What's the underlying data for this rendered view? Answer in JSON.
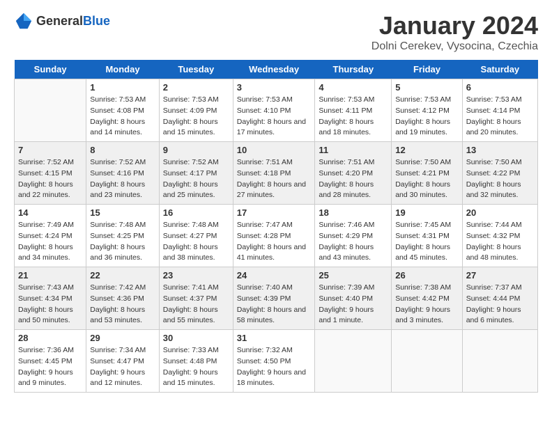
{
  "header": {
    "logo_general": "General",
    "logo_blue": "Blue",
    "title": "January 2024",
    "subtitle": "Dolni Cerekev, Vysocina, Czechia"
  },
  "weekdays": [
    "Sunday",
    "Monday",
    "Tuesday",
    "Wednesday",
    "Thursday",
    "Friday",
    "Saturday"
  ],
  "weeks": [
    [
      {
        "date": "",
        "sunrise": "",
        "sunset": "",
        "daylight": ""
      },
      {
        "date": "1",
        "sunrise": "Sunrise: 7:53 AM",
        "sunset": "Sunset: 4:08 PM",
        "daylight": "Daylight: 8 hours and 14 minutes."
      },
      {
        "date": "2",
        "sunrise": "Sunrise: 7:53 AM",
        "sunset": "Sunset: 4:09 PM",
        "daylight": "Daylight: 8 hours and 15 minutes."
      },
      {
        "date": "3",
        "sunrise": "Sunrise: 7:53 AM",
        "sunset": "Sunset: 4:10 PM",
        "daylight": "Daylight: 8 hours and 17 minutes."
      },
      {
        "date": "4",
        "sunrise": "Sunrise: 7:53 AM",
        "sunset": "Sunset: 4:11 PM",
        "daylight": "Daylight: 8 hours and 18 minutes."
      },
      {
        "date": "5",
        "sunrise": "Sunrise: 7:53 AM",
        "sunset": "Sunset: 4:12 PM",
        "daylight": "Daylight: 8 hours and 19 minutes."
      },
      {
        "date": "6",
        "sunrise": "Sunrise: 7:53 AM",
        "sunset": "Sunset: 4:14 PM",
        "daylight": "Daylight: 8 hours and 20 minutes."
      }
    ],
    [
      {
        "date": "7",
        "sunrise": "Sunrise: 7:52 AM",
        "sunset": "Sunset: 4:15 PM",
        "daylight": "Daylight: 8 hours and 22 minutes."
      },
      {
        "date": "8",
        "sunrise": "Sunrise: 7:52 AM",
        "sunset": "Sunset: 4:16 PM",
        "daylight": "Daylight: 8 hours and 23 minutes."
      },
      {
        "date": "9",
        "sunrise": "Sunrise: 7:52 AM",
        "sunset": "Sunset: 4:17 PM",
        "daylight": "Daylight: 8 hours and 25 minutes."
      },
      {
        "date": "10",
        "sunrise": "Sunrise: 7:51 AM",
        "sunset": "Sunset: 4:18 PM",
        "daylight": "Daylight: 8 hours and 27 minutes."
      },
      {
        "date": "11",
        "sunrise": "Sunrise: 7:51 AM",
        "sunset": "Sunset: 4:20 PM",
        "daylight": "Daylight: 8 hours and 28 minutes."
      },
      {
        "date": "12",
        "sunrise": "Sunrise: 7:50 AM",
        "sunset": "Sunset: 4:21 PM",
        "daylight": "Daylight: 8 hours and 30 minutes."
      },
      {
        "date": "13",
        "sunrise": "Sunrise: 7:50 AM",
        "sunset": "Sunset: 4:22 PM",
        "daylight": "Daylight: 8 hours and 32 minutes."
      }
    ],
    [
      {
        "date": "14",
        "sunrise": "Sunrise: 7:49 AM",
        "sunset": "Sunset: 4:24 PM",
        "daylight": "Daylight: 8 hours and 34 minutes."
      },
      {
        "date": "15",
        "sunrise": "Sunrise: 7:48 AM",
        "sunset": "Sunset: 4:25 PM",
        "daylight": "Daylight: 8 hours and 36 minutes."
      },
      {
        "date": "16",
        "sunrise": "Sunrise: 7:48 AM",
        "sunset": "Sunset: 4:27 PM",
        "daylight": "Daylight: 8 hours and 38 minutes."
      },
      {
        "date": "17",
        "sunrise": "Sunrise: 7:47 AM",
        "sunset": "Sunset: 4:28 PM",
        "daylight": "Daylight: 8 hours and 41 minutes."
      },
      {
        "date": "18",
        "sunrise": "Sunrise: 7:46 AM",
        "sunset": "Sunset: 4:29 PM",
        "daylight": "Daylight: 8 hours and 43 minutes."
      },
      {
        "date": "19",
        "sunrise": "Sunrise: 7:45 AM",
        "sunset": "Sunset: 4:31 PM",
        "daylight": "Daylight: 8 hours and 45 minutes."
      },
      {
        "date": "20",
        "sunrise": "Sunrise: 7:44 AM",
        "sunset": "Sunset: 4:32 PM",
        "daylight": "Daylight: 8 hours and 48 minutes."
      }
    ],
    [
      {
        "date": "21",
        "sunrise": "Sunrise: 7:43 AM",
        "sunset": "Sunset: 4:34 PM",
        "daylight": "Daylight: 8 hours and 50 minutes."
      },
      {
        "date": "22",
        "sunrise": "Sunrise: 7:42 AM",
        "sunset": "Sunset: 4:36 PM",
        "daylight": "Daylight: 8 hours and 53 minutes."
      },
      {
        "date": "23",
        "sunrise": "Sunrise: 7:41 AM",
        "sunset": "Sunset: 4:37 PM",
        "daylight": "Daylight: 8 hours and 55 minutes."
      },
      {
        "date": "24",
        "sunrise": "Sunrise: 7:40 AM",
        "sunset": "Sunset: 4:39 PM",
        "daylight": "Daylight: 8 hours and 58 minutes."
      },
      {
        "date": "25",
        "sunrise": "Sunrise: 7:39 AM",
        "sunset": "Sunset: 4:40 PM",
        "daylight": "Daylight: 9 hours and 1 minute."
      },
      {
        "date": "26",
        "sunrise": "Sunrise: 7:38 AM",
        "sunset": "Sunset: 4:42 PM",
        "daylight": "Daylight: 9 hours and 3 minutes."
      },
      {
        "date": "27",
        "sunrise": "Sunrise: 7:37 AM",
        "sunset": "Sunset: 4:44 PM",
        "daylight": "Daylight: 9 hours and 6 minutes."
      }
    ],
    [
      {
        "date": "28",
        "sunrise": "Sunrise: 7:36 AM",
        "sunset": "Sunset: 4:45 PM",
        "daylight": "Daylight: 9 hours and 9 minutes."
      },
      {
        "date": "29",
        "sunrise": "Sunrise: 7:34 AM",
        "sunset": "Sunset: 4:47 PM",
        "daylight": "Daylight: 9 hours and 12 minutes."
      },
      {
        "date": "30",
        "sunrise": "Sunrise: 7:33 AM",
        "sunset": "Sunset: 4:48 PM",
        "daylight": "Daylight: 9 hours and 15 minutes."
      },
      {
        "date": "31",
        "sunrise": "Sunrise: 7:32 AM",
        "sunset": "Sunset: 4:50 PM",
        "daylight": "Daylight: 9 hours and 18 minutes."
      },
      {
        "date": "",
        "sunrise": "",
        "sunset": "",
        "daylight": ""
      },
      {
        "date": "",
        "sunrise": "",
        "sunset": "",
        "daylight": ""
      },
      {
        "date": "",
        "sunrise": "",
        "sunset": "",
        "daylight": ""
      }
    ]
  ]
}
